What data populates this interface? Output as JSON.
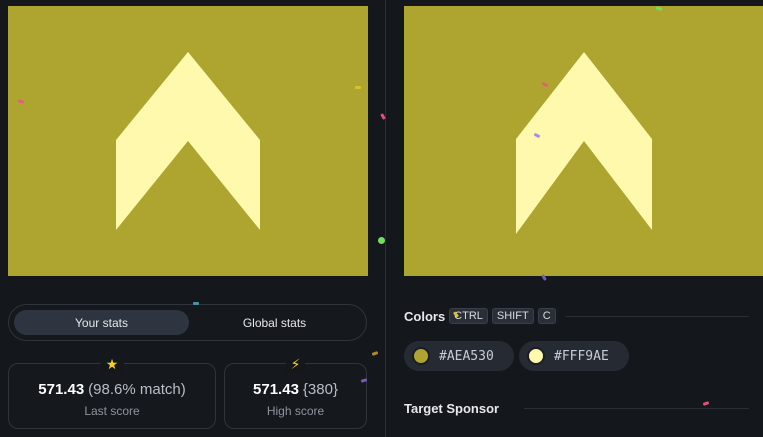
{
  "left_canvas": {
    "background": "#AEA530",
    "shape": "#FFF9AE"
  },
  "right_canvas": {
    "background": "#AEA530",
    "shape": "#FFF9AE"
  },
  "stats_toggle": {
    "active": "Your stats",
    "inactive": "Global stats"
  },
  "last_score": {
    "icon": "star-icon",
    "value": "571.43",
    "extra": "(98.6% match)",
    "label": "Last score"
  },
  "high_score": {
    "icon": "lightning-icon",
    "value": "571.43",
    "extra": "{380}",
    "label": "High score"
  },
  "colors": {
    "title": "Colors",
    "shortcut": [
      "CTRL",
      "SHIFT",
      "C"
    ],
    "swatches": [
      {
        "hex": "#AEA530",
        "color": "#AEA530"
      },
      {
        "hex": "#FFF9AE",
        "color": "#FFF9AE"
      }
    ]
  },
  "target_sponsor": {
    "title": "Target Sponsor"
  }
}
